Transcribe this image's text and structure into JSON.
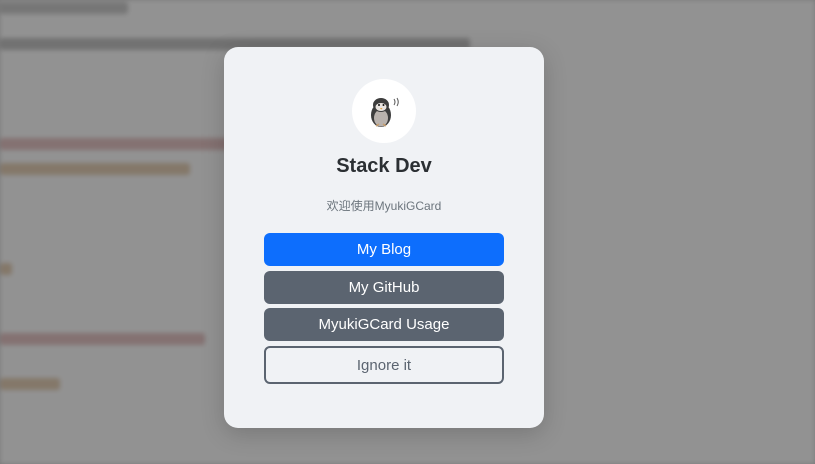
{
  "card": {
    "avatar_icon": "penguin-icon",
    "title": "Stack Dev",
    "subtitle": "欢迎使用MyukiGCard",
    "buttons": {
      "blog": "My Blog",
      "github": "My GitHub",
      "usage": "MyukiGCard Usage",
      "ignore": "Ignore it"
    }
  },
  "colors": {
    "primary": "#0d6efd",
    "secondary": "#5b6470",
    "card_background": "#f0f2f5"
  }
}
